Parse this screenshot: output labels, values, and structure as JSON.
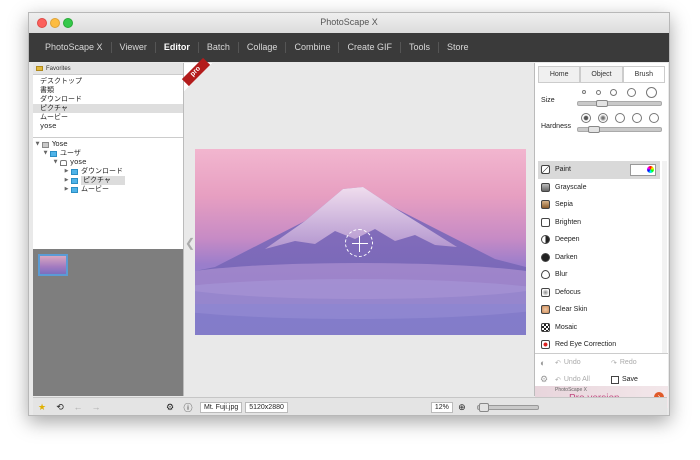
{
  "window": {
    "title": "PhotoScape X"
  },
  "menu": [
    "PhotoScape X",
    "Viewer",
    "Editor",
    "Batch",
    "Collage",
    "Combine",
    "Create GIF",
    "Tools",
    "Store"
  ],
  "menu_active": "Editor",
  "left": {
    "favorites_label": "Favorites",
    "favorites": [
      "デスクトップ",
      "書類",
      "ダウンロード",
      "ピクチャ",
      "ムービー",
      "yose"
    ],
    "favorites_selected": "ピクチャ",
    "tree": [
      {
        "label": "Yose",
        "icon": "disk-icon",
        "level": 0
      },
      {
        "label": "ユーザ",
        "icon": "folder-icon",
        "level": 1
      },
      {
        "label": "yose",
        "icon": "home-icon",
        "level": 2
      },
      {
        "label": "ダウンロード",
        "icon": "folder-icon",
        "level": 3
      },
      {
        "label": "ピクチャ",
        "icon": "folder-icon",
        "level": 3,
        "selected": true
      },
      {
        "label": "ムービー",
        "icon": "folder-icon",
        "level": 3
      }
    ]
  },
  "center": {
    "pro_badge": "pro"
  },
  "right": {
    "tabs": [
      "Home",
      "Object",
      "Brush"
    ],
    "active_tab": "Brush",
    "size_label": "Size",
    "hardness_label": "Hardness",
    "size_value": 0.22,
    "hardness_value": 0.12,
    "tools": [
      "Paint",
      "Grayscale",
      "Sepia",
      "Brighten",
      "Deepen",
      "Darken",
      "Blur",
      "Defocus",
      "Clear Skin",
      "Mosaic",
      "Red Eye Correction"
    ],
    "selected_tool": "Paint",
    "undo": "Undo",
    "redo": "Redo",
    "undo_all": "Undo All",
    "save": "Save",
    "promo_small": "PhotoScape X",
    "promo_big": "Pro version"
  },
  "status": {
    "filename": "Mt. Fuji.jpg",
    "dimensions": "5120x2880",
    "zoom": "12%"
  }
}
